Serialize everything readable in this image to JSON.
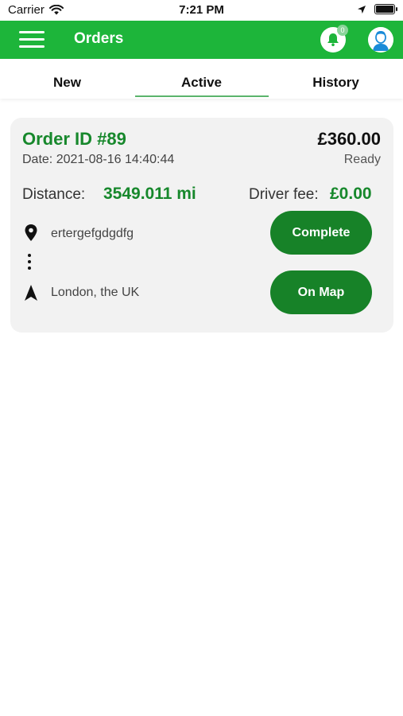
{
  "status_bar": {
    "carrier": "Carrier",
    "time": "7:21 PM"
  },
  "app_bar": {
    "title": "Orders",
    "notification_count": "0",
    "background_color": "#1db53a"
  },
  "tabs": [
    {
      "label": "New"
    },
    {
      "label": "Active",
      "selected": true
    },
    {
      "label": "History"
    }
  ],
  "order": {
    "id_label": "Order ID #89",
    "date": "Date: 2021-08-16 14:40:44",
    "price": "£360.00",
    "status": "Ready",
    "distance_label": "Distance:",
    "distance_value": "3549.011 mi",
    "driver_fee_label": "Driver fee:",
    "driver_fee_value": "£0.00",
    "pickup_address": "ertergefgdgdfg",
    "dropoff_address": "London, the UK",
    "complete_label": "Complete",
    "map_label": "On Map",
    "accent_color": "#17882c"
  },
  "icons": {
    "menu": "hamburger-menu-icon",
    "bell": "bell-icon",
    "avatar": "user-avatar-icon",
    "pickup": "location-pin-icon",
    "route": "vertical-dots-icon",
    "dropoff": "navigation-arrow-icon",
    "wifi": "wifi-icon",
    "location": "location-arrow-icon",
    "battery": "battery-icon"
  }
}
